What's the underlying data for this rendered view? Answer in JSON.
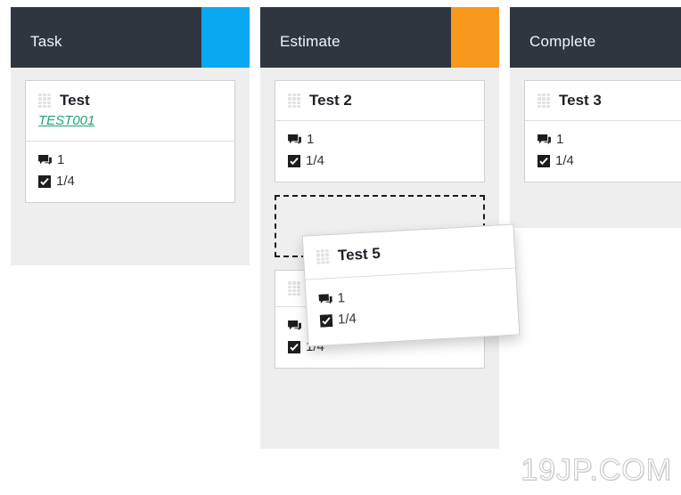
{
  "board": {
    "columns": [
      {
        "title": "Task",
        "accent_color": "#0aa8f0",
        "header_bg": "#2f3640",
        "cards": [
          {
            "title": "Test",
            "subtitle": "TEST001",
            "comments_label": "1",
            "checklist_label": "1/4"
          }
        ]
      },
      {
        "title": "Estimate",
        "accent_color": "#f8991d",
        "header_bg": "#2f3640",
        "cards": [
          {
            "title": "Test 2",
            "subtitle": "",
            "comments_label": "1",
            "checklist_label": "1/4"
          },
          {
            "title": "",
            "subtitle": "",
            "comments_label": "1",
            "checklist_label": "1/4"
          }
        ]
      },
      {
        "title": "Complete",
        "accent_color": "#2f3640",
        "header_bg": "#2f3640",
        "cards": [
          {
            "title": "Test 3",
            "subtitle": "",
            "comments_label": "1",
            "checklist_label": "1/4"
          }
        ]
      }
    ]
  },
  "drag": {
    "card": {
      "title": "Test 5",
      "comments_label": "1",
      "checklist_label": "1/4"
    }
  },
  "icons": {
    "drag_handle": "drag-handle-icon",
    "comment": "comment-icon",
    "checkbox": "checkbox-checked-icon"
  },
  "watermark": {
    "text": "19JP.COM"
  }
}
